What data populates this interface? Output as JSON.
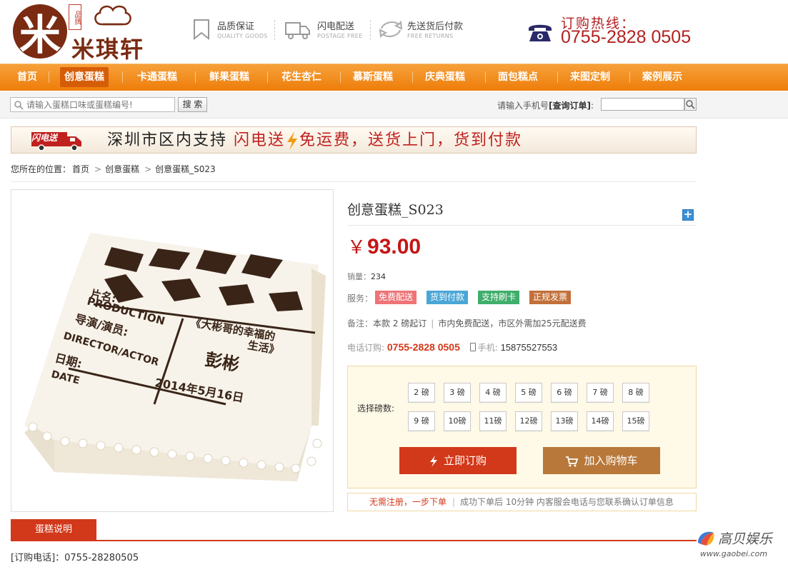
{
  "brand": {
    "logo_text": "米琪轩",
    "seal_text": "品牌"
  },
  "features": [
    {
      "title": "品质保证",
      "subtitle": "QUALITY GOODS",
      "icon": "bookmark-icon"
    },
    {
      "title": "闪电配送",
      "subtitle": "POSTAGE FREE",
      "icon": "delivery-truck-icon"
    },
    {
      "title": "先送货后付款",
      "subtitle": "FREE RETURNS",
      "icon": "return-arrows-icon"
    }
  ],
  "hotline": {
    "label": "订购热线：",
    "number": "0755-2828 0505",
    "icon": "telephone-icon"
  },
  "nav": {
    "items": [
      "首页",
      "创意蛋糕",
      "卡通蛋糕",
      "鲜果蛋糕",
      "花生杏仁",
      "慕斯蛋糕",
      "庆典蛋糕",
      "面包糕点",
      "来图定制",
      "案例展示"
    ],
    "active_index": 1
  },
  "search": {
    "placeholder": "请输入蛋糕口味或蛋糕编号!",
    "button_label": "搜 索",
    "order_prefix": "请输入手机号",
    "order_bold": "[查询订单]",
    "order_suffix": ":"
  },
  "banner": {
    "badge": "闪电送",
    "text_black": "深圳市区内支持 ",
    "text_red_1": "闪电送",
    "text_red_2": "免运费，送货上门，货到付款"
  },
  "breadcrumb": {
    "prefix": "您所在的位置：",
    "items": [
      "首页",
      "创意蛋糕",
      "创意蛋糕_S023"
    ]
  },
  "product": {
    "title": "创意蛋糕_S023",
    "currency": "￥",
    "price": "93.00",
    "sales_label": "销量：",
    "sales_value": "234",
    "services_label": "服务：",
    "services": [
      {
        "label": "免费配送",
        "color": "#ee7478"
      },
      {
        "label": "货到付款",
        "color": "#4aa6d6"
      },
      {
        "label": "支持刷卡",
        "color": "#3fae6b"
      },
      {
        "label": "正规发票",
        "color": "#c2703a"
      }
    ],
    "note_label": "备注：",
    "note_a": "本款 2 磅起订",
    "note_b": "市内免费配送，市区外需加25元配送费",
    "phone_label": "电话订购:",
    "phone": "0755-2828 0505",
    "mobile_label": "手机:",
    "mobile": "15875527553",
    "image_texts": {
      "l1": "片名:",
      "l2": "PRODUCTION",
      "l3": "导演/演员:",
      "l4": "DIRECTOR/ACTOR",
      "l5": "日期:",
      "l6": "DATE",
      "r1": "《大彬哥的幸福的",
      "r2": "生活》",
      "name": "彭彬",
      "date": "2014年5月16日"
    }
  },
  "weights": {
    "label": "选择磅数:",
    "row1": [
      "2 磅",
      "3 磅",
      "4 磅",
      "5 磅",
      "6 磅",
      "7 磅",
      "8 磅"
    ],
    "row2": [
      "9 磅",
      "10磅",
      "11磅",
      "12磅",
      "13磅",
      "14磅",
      "15磅"
    ]
  },
  "actions": {
    "buy_now": "立即订购",
    "add_cart": "加入购物车"
  },
  "tips": {
    "highlight": "无需注册，一步下单",
    "text": "成功下单后 10分钟 内客服会电话与您联系确认订单信息"
  },
  "description": {
    "tab": "蛋糕说明",
    "text": "[订购电话]：0755-28280505"
  },
  "watermark": {
    "name": "高贝娱乐",
    "url": "www.gaobei.com"
  },
  "colors": {
    "nav_orange": "#ee7d0a",
    "brand_red": "#d2381a",
    "brand_brown": "#7a2b12",
    "cart_brown": "#b8783a"
  }
}
